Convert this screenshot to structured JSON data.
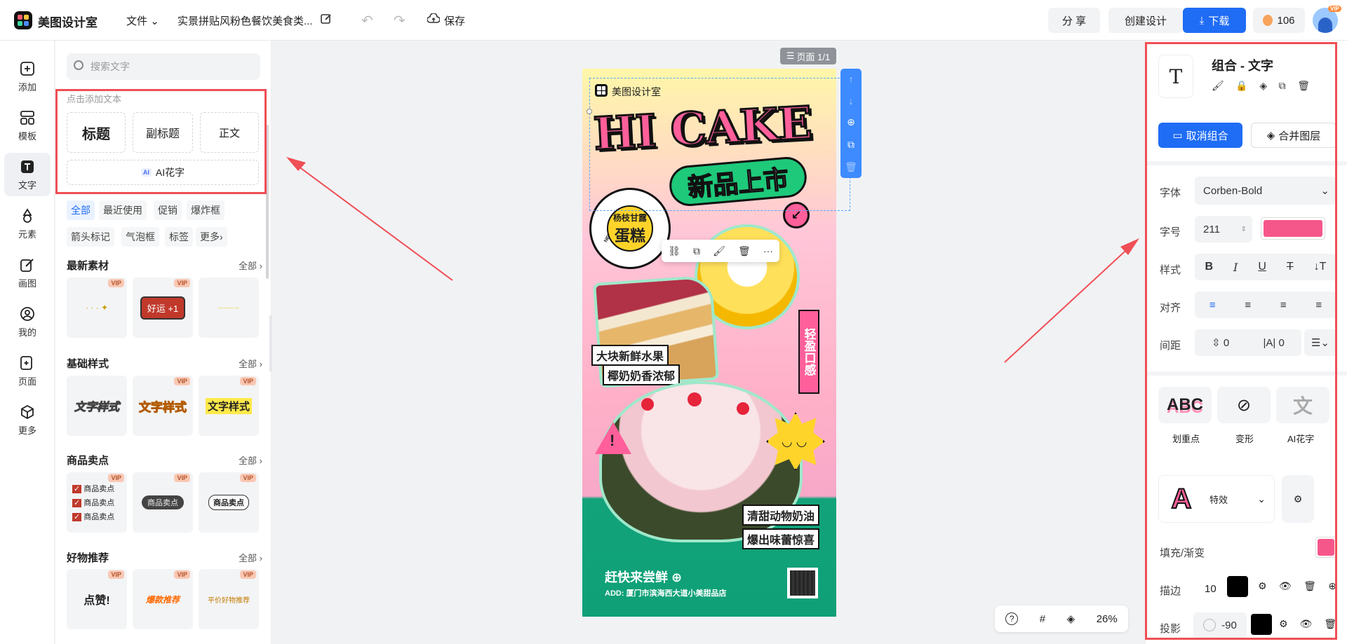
{
  "colors": {
    "accent": "#1f6cf5",
    "red": "#ef4f55",
    "fill": "#f6578a"
  },
  "topbar": {
    "app_name": "美图设计室",
    "file_menu": "文件",
    "doc_title": "实景拼贴风粉色餐饮美食类...",
    "save": "保存",
    "share": "分 享",
    "create": "创建设计",
    "download": "下载",
    "coins": "106",
    "avatar_badge": "VIP"
  },
  "leftnav": [
    {
      "label": "添加",
      "icon": "plus-square-icon"
    },
    {
      "label": "模板",
      "icon": "template-icon"
    },
    {
      "label": "文字",
      "icon": "text-icon"
    },
    {
      "label": "元素",
      "icon": "shapes-icon"
    },
    {
      "label": "画图",
      "icon": "pen-icon"
    },
    {
      "label": "我的",
      "icon": "user-icon"
    },
    {
      "label": "页面",
      "icon": "page-add-icon"
    },
    {
      "label": "更多",
      "icon": "cube-icon"
    }
  ],
  "panel": {
    "search_placeholder": "搜索文字",
    "add_text_hint": "点击添加文本",
    "title_btn": "标题",
    "subtitle_btn": "副标题",
    "body_btn": "正文",
    "ai_badge": "AI",
    "ai_btn": "AI花字",
    "tags": [
      "全部",
      "最近使用",
      "促销",
      "爆炸框",
      "箭头标记",
      "气泡框",
      "标签",
      "更多"
    ],
    "all_label": "全部",
    "sections": [
      {
        "title": "最新素材",
        "items": [
          {
            "text": "",
            "vip": "VIP"
          },
          {
            "text": "好运 +1",
            "vip": "VIP"
          },
          {
            "text": "",
            "vip": ""
          }
        ]
      },
      {
        "title": "基础样式",
        "items": [
          {
            "text": "文字样式",
            "vip": ""
          },
          {
            "text": "文字样式",
            "vip": "VIP"
          },
          {
            "text": "文字样式",
            "vip": "VIP"
          }
        ]
      },
      {
        "title": "商品卖点",
        "items": [
          {
            "text": "商品卖点",
            "vip": "VIP"
          },
          {
            "text": "商品卖点",
            "vip": "VIP"
          },
          {
            "text": "商品卖点",
            "vip": "VIP"
          }
        ]
      },
      {
        "title": "好物推荐",
        "items": [
          {
            "text": "点赞!",
            "vip": "VIP"
          },
          {
            "text": "爆款推荐",
            "vip": "VIP"
          },
          {
            "text": "平价好物推荐",
            "vip": "VIP"
          }
        ]
      }
    ]
  },
  "canvas": {
    "page_label": "页面 1/1",
    "zoom": "26%"
  },
  "poster": {
    "brand": "美图设计室",
    "headline": "HI CAKE",
    "sub": "新品上市",
    "badge_top": "杨枝甘露",
    "badge_main": "蛋糕",
    "ring_text": "NEW ARRIVAL",
    "vertical": "轻盈口感",
    "label1": "大块新鲜水果",
    "label2": "椰奶奶香浓郁",
    "label3": "清甜动物奶油",
    "label4": "爆出味蕾惊喜",
    "cta": "赶快来尝鲜",
    "address": "ADD: 厦门市滨海西大道小美甜品店"
  },
  "rightpanel": {
    "title": "组合 - 文字",
    "ungroup": "取消组合",
    "merge": "合并图层",
    "font_label": "字体",
    "font_value": "Corben-Bold",
    "size_label": "字号",
    "size_value": "211",
    "style_label": "样式",
    "align_label": "对齐",
    "spacing_label": "间距",
    "spacing_a": "0",
    "spacing_b": "0",
    "fx1": "划重点",
    "fx2": "变形",
    "fx3": "AI花字",
    "effect": "特效",
    "fill_label": "填充/渐变",
    "stroke_label": "描边",
    "stroke_value": "10",
    "shadow_label": "投影",
    "shadow_value": "-90",
    "fill_color": "#f6578a",
    "stroke_color": "#000000"
  }
}
